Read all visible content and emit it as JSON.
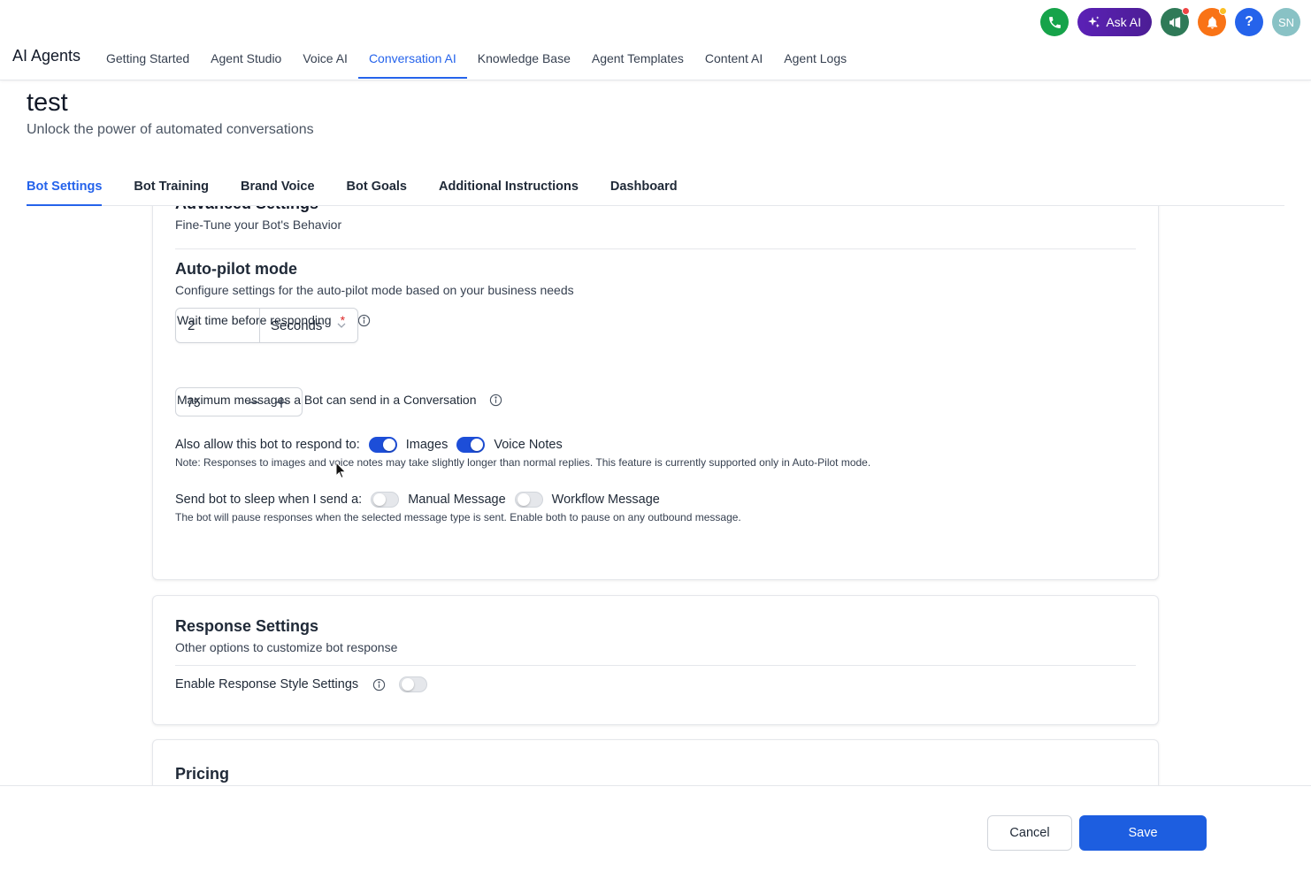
{
  "header": {
    "brand": "AI Agents",
    "ask_ai_label": "Ask AI",
    "help_label": "?",
    "avatar_initials": "SN",
    "nav": [
      {
        "label": "Getting Started"
      },
      {
        "label": "Agent Studio"
      },
      {
        "label": "Voice AI"
      },
      {
        "label": "Conversation AI",
        "active": true
      },
      {
        "label": "Knowledge Base"
      },
      {
        "label": "Agent Templates"
      },
      {
        "label": "Content AI"
      },
      {
        "label": "Agent Logs"
      }
    ],
    "icons": [
      "phone-icon",
      "sparkle-icon",
      "megaphone-icon",
      "bell-icon",
      "help-icon"
    ]
  },
  "page": {
    "title": "test",
    "subtitle": "Unlock the power of automated conversations"
  },
  "tabs": [
    {
      "label": "Bot Settings",
      "active": true
    },
    {
      "label": "Bot Training"
    },
    {
      "label": "Brand Voice"
    },
    {
      "label": "Bot Goals"
    },
    {
      "label": "Additional Instructions"
    },
    {
      "label": "Dashboard"
    }
  ],
  "advanced": {
    "title": "Advanced Settings",
    "subtitle": "Fine-Tune your Bot's Behavior"
  },
  "autopilot": {
    "title": "Auto-pilot mode",
    "subtitle": "Configure settings for the auto-pilot mode based on your business needs",
    "wait_label": "Wait time before responding",
    "required_mark": "*",
    "wait_value": "2",
    "wait_unit": "Seconds",
    "max_label": "Maximum messages a Bot can send in a Conversation",
    "max_value": "75",
    "respond_label": "Also allow this bot to respond to:",
    "images_label": "Images",
    "images_on": true,
    "voice_label": "Voice Notes",
    "voice_on": true,
    "respond_note": "Note: Responses to images and voice notes may take slightly longer than normal replies. This feature is currently supported only in Auto-Pilot mode.",
    "sleep_label": "Send bot to sleep when I send a:",
    "manual_label": "Manual Message",
    "manual_on": false,
    "workflow_label": "Workflow Message",
    "workflow_on": false,
    "sleep_note": "The bot will pause responses when the selected message type is sent. Enable both to pause on any outbound message."
  },
  "response": {
    "title": "Response Settings",
    "subtitle": "Other options to customize bot response",
    "style_label": "Enable Response Style Settings",
    "style_on": false
  },
  "pricing": {
    "title": "Pricing"
  },
  "footer": {
    "cancel_label": "Cancel",
    "save_label": "Save"
  },
  "colors": {
    "accent": "#2563eb",
    "save_button": "#1d5ee0",
    "phone": "#16a34a",
    "ask_ai": "#5b21b6",
    "bell": "#f97316"
  }
}
